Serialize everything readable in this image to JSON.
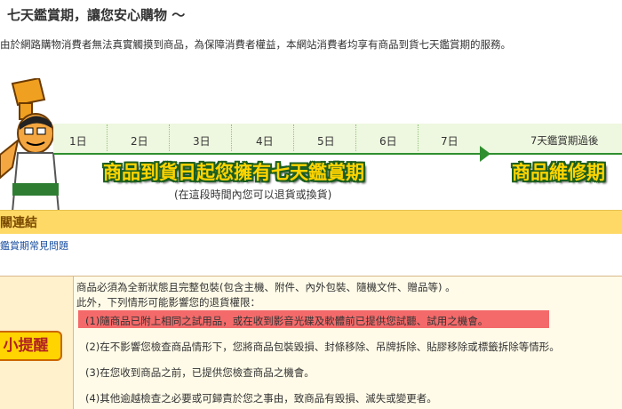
{
  "header": {
    "title": "七天鑑賞期，讓您安心購物 ～"
  },
  "intro": {
    "text": "由於網路購物消費者無法真實觸摸到商品，為保障消費者權益，本網站消費者均享有商品到貨七天鑑賞期的服務。"
  },
  "timeline": {
    "days": [
      "1日",
      "2日",
      "3日",
      "4日",
      "5日",
      "6日",
      "7日"
    ],
    "after_label": "7天鑑賞期過後",
    "main_banner": "商品到貨日起您擁有七天鑑賞期",
    "right_banner": "商品維修期",
    "note": "(在這段時間內您可以退貨或換貨)"
  },
  "related": {
    "title": "關連結",
    "faq_link": "鑑賞期常見問題"
  },
  "reminder": {
    "badge": "小提醒",
    "line1": "商品必須為全新狀態且完整包裝(包含主機、附件、內外包裝、隨機文件、贈品等) 。",
    "line2": "此外，下列情形可能影響您的退貨權限：",
    "items": [
      "(1)隨商品已附上相同之試用品，或在收到影音光碟及軟體前已提供您試聽、試用之機會。",
      "(2)在不影響您檢查商品情形下，您將商品包裝毀損、封條移除、吊牌拆除、貼膠移除或標籤拆除等情形。",
      "(3)在您收到商品之前，已提供您檢查商品之機會。",
      "(4)其他逾越檢查之必要或可歸責於您之事由，致商品有毀損、滅失或變更者。"
    ],
    "highlight_color": "#f46a6a"
  },
  "colors": {
    "accent_green": "#2f8f2f",
    "banner_yellow": "#ffd400",
    "section_bar": "#ffd966"
  }
}
